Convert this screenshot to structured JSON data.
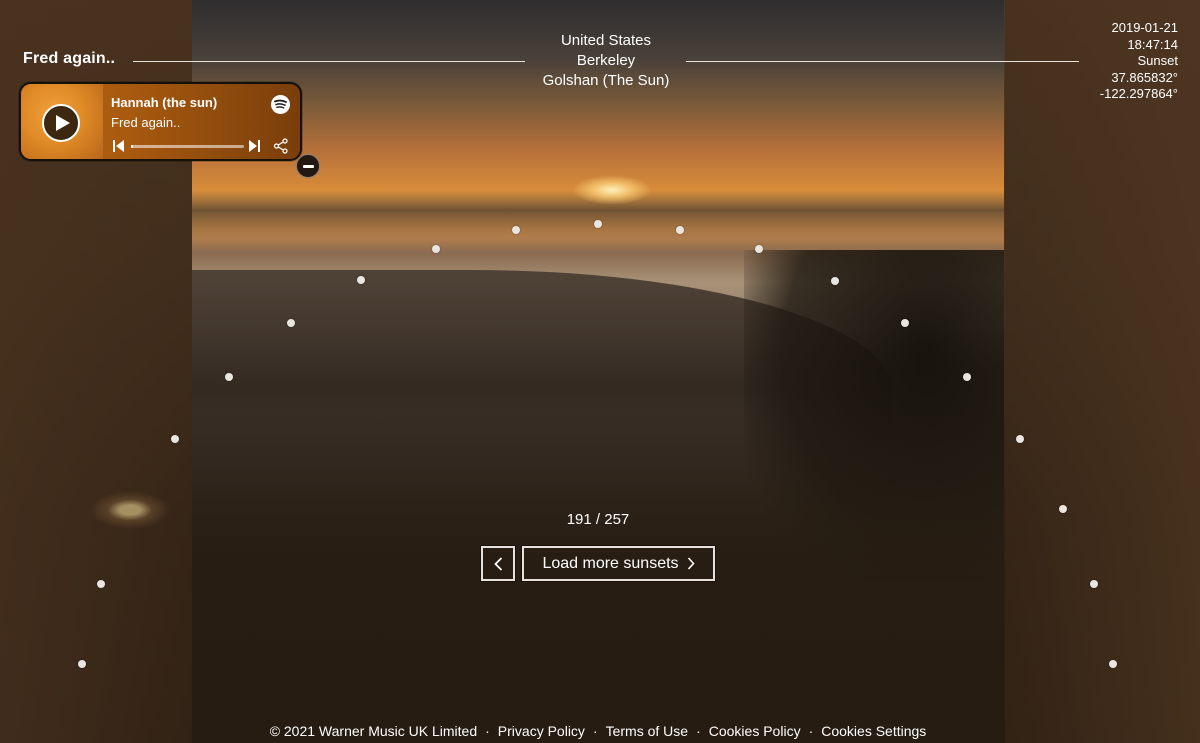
{
  "artist": "Fred again..",
  "location": {
    "country": "United States",
    "city": "Berkeley",
    "contributor": "Golshan (The Sun)"
  },
  "meta": {
    "date": "2019-01-21",
    "time": "18:47:14",
    "type": "Sunset",
    "lat": "37.865832°",
    "lon": "-122.297864°"
  },
  "player": {
    "track": "Hannah (the sun)",
    "artist": "Fred again..",
    "progress": 0.02,
    "icons": [
      "play-icon",
      "spotify-icon",
      "previous-icon",
      "next-icon",
      "share-icon",
      "minus-icon"
    ]
  },
  "counter": "191 / 257",
  "buttons": {
    "load_more": "Load more sunsets"
  },
  "footer": {
    "copyright": "© 2021 Warner Music UK Limited",
    "links": [
      "Privacy Policy",
      "Terms of Use",
      "Cookies Policy",
      "Cookies Settings"
    ],
    "separator": "·"
  },
  "colors": {
    "player_bg": "#b86512",
    "text": "#ffffff",
    "dot": "#e9e6e2"
  }
}
